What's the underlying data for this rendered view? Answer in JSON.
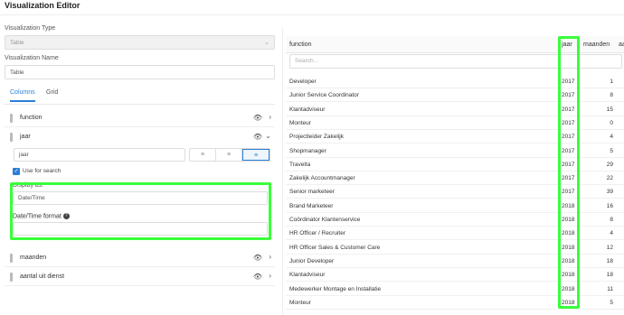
{
  "page": {
    "title": "Visualization Editor"
  },
  "form": {
    "type_label": "Visualization Type",
    "type_value": "Table",
    "name_label": "Visualization Name",
    "name_value": "Table"
  },
  "tabs": [
    {
      "label": "Columns",
      "active": true
    },
    {
      "label": "Grid",
      "active": false
    }
  ],
  "columns": [
    {
      "name": "function"
    },
    {
      "name": "jaar"
    },
    {
      "name": "maanden"
    },
    {
      "name": "aantal uit dienst"
    }
  ],
  "editor": {
    "column_title_value": "jaar",
    "use_for_search_label": "Use for search",
    "display_as_label": "Display as:",
    "display_as_value": "Date/Time",
    "format_label": "Date/Time format",
    "help_icon": "?"
  },
  "icons": {
    "eye": "eye-icon",
    "chevron_right": "chevron-right-icon",
    "chevron_down": "chevron-down-icon",
    "align_left": "align-left-icon",
    "align_center": "align-center-icon",
    "align_right": "align-right-icon",
    "drag": "drag-handle-icon"
  },
  "table": {
    "headers": {
      "function": "function",
      "jaar": "jaar",
      "maanden": "maanden",
      "extra": "aa"
    },
    "search_placeholder": "Search...",
    "rows": [
      {
        "function": "Developer",
        "jaar": "2017",
        "maanden": "1"
      },
      {
        "function": "Junior Service Coordinator",
        "jaar": "2017",
        "maanden": "8"
      },
      {
        "function": "Klantadviseur",
        "jaar": "2017",
        "maanden": "15"
      },
      {
        "function": "Monteur",
        "jaar": "2017",
        "maanden": "0"
      },
      {
        "function": "Projectleider Zakelijk",
        "jaar": "2017",
        "maanden": "4"
      },
      {
        "function": "Shopmanager",
        "jaar": "2017",
        "maanden": "5"
      },
      {
        "function": "Travelta",
        "jaar": "2017",
        "maanden": "29"
      },
      {
        "function": "Zakelijk Accountmanager",
        "jaar": "2017",
        "maanden": "22"
      },
      {
        "function": "Senior marketeer",
        "jaar": "2017",
        "maanden": "39"
      },
      {
        "function": "Brand Marketeer",
        "jaar": "2018",
        "maanden": "16"
      },
      {
        "function": "Coördinator Klantenservice",
        "jaar": "2018",
        "maanden": "8"
      },
      {
        "function": "HR Officer / Recruiter",
        "jaar": "2018",
        "maanden": "4"
      },
      {
        "function": "HR Officer Sales & Customer Care",
        "jaar": "2018",
        "maanden": "12"
      },
      {
        "function": "Junior Developer",
        "jaar": "2018",
        "maanden": "18"
      },
      {
        "function": "Klantadviseur",
        "jaar": "2018",
        "maanden": "18"
      },
      {
        "function": "Medewerker Montage en Installatie",
        "jaar": "2018",
        "maanden": "11"
      },
      {
        "function": "Monteur",
        "jaar": "2018",
        "maanden": "5"
      }
    ]
  },
  "colors": {
    "accent": "#2a7fd8",
    "highlight": "#39ff3a"
  }
}
